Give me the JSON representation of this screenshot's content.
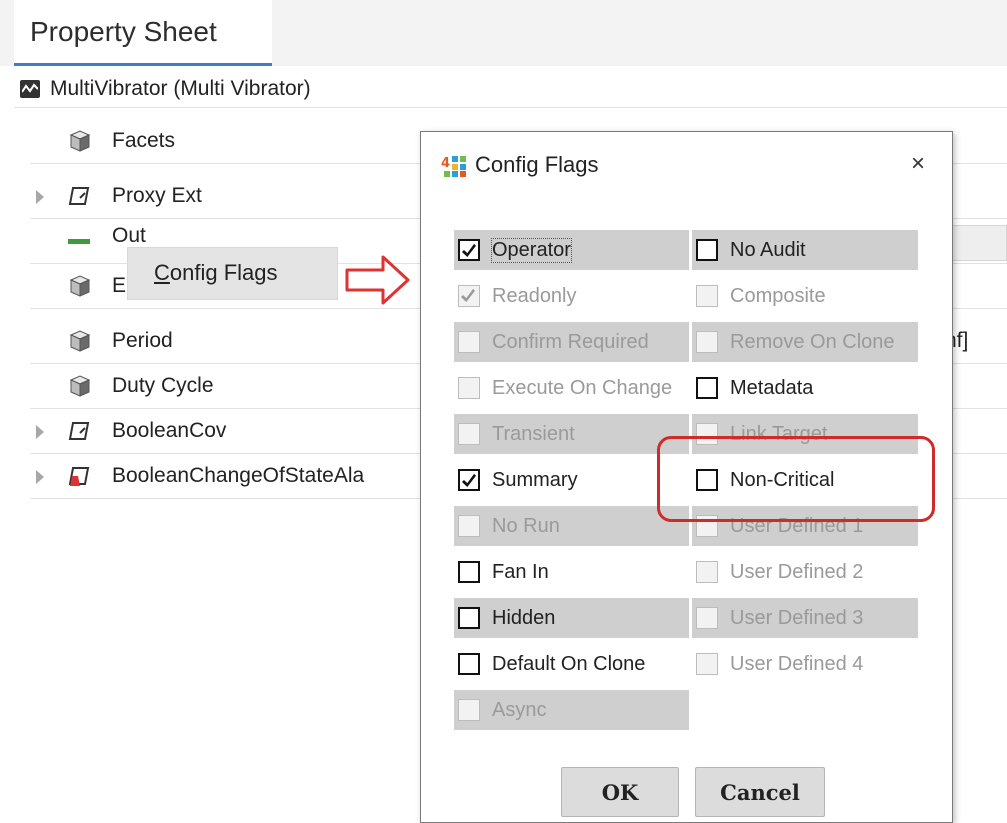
{
  "tab": {
    "title": "Property Sheet"
  },
  "tree": {
    "root_label": "MultiVibrator  (Multi Vibrator)",
    "rows": [
      {
        "label": "Facets",
        "value": "⊕ ▾"
      },
      {
        "label": "Proxy Ext",
        "value": ""
      },
      {
        "label": "Out",
        "value": ""
      },
      {
        "label": "Enabled",
        "value": ""
      },
      {
        "label": "Period",
        "value": "nf]"
      },
      {
        "label": "Duty Cycle",
        "value": ""
      },
      {
        "label": "BooleanCov",
        "value": ""
      },
      {
        "label": "BooleanChangeOfStateAla",
        "value": ""
      }
    ]
  },
  "context_menu": {
    "label_prefix": "",
    "label_mnemonic": "C",
    "label_rest": "onfig Flags"
  },
  "dialog": {
    "title": "Config Flags",
    "close_glyph": "×",
    "flags_left": [
      {
        "label": "Operator",
        "checked": true
      },
      {
        "label": "Readonly",
        "checked": true
      },
      {
        "label": "Confirm Required",
        "checked": false
      },
      {
        "label": "Execute On Change",
        "checked": false
      },
      {
        "label": "Transient",
        "checked": false
      },
      {
        "label": "Summary",
        "checked": true
      },
      {
        "label": "No Run",
        "checked": false
      },
      {
        "label": "Fan In",
        "checked": false
      },
      {
        "label": "Hidden",
        "checked": false
      },
      {
        "label": "Default On Clone",
        "checked": false
      },
      {
        "label": "Async",
        "checked": false
      }
    ],
    "flags_right": [
      {
        "label": "No Audit",
        "checked": false
      },
      {
        "label": "Composite",
        "checked": false
      },
      {
        "label": "Remove On Clone",
        "checked": false
      },
      {
        "label": "Metadata",
        "checked": false
      },
      {
        "label": "Link Target",
        "checked": false
      },
      {
        "label": "Non-Critical",
        "checked": false
      },
      {
        "label": "User Defined 1",
        "checked": false
      },
      {
        "label": "User Defined 2",
        "checked": false
      },
      {
        "label": "User Defined 3",
        "checked": false
      },
      {
        "label": "User Defined 4",
        "checked": false
      }
    ],
    "ok_label": "OK",
    "cancel_label": "Cancel"
  },
  "colors": {
    "tab_underline": "#3b7fc4",
    "highlight": "#cf2b2b",
    "out_bar": "#3f9a3f"
  }
}
